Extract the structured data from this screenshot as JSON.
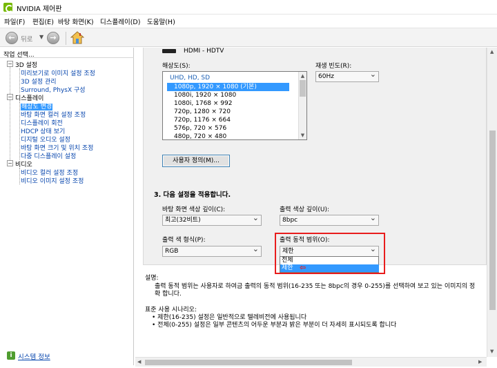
{
  "window": {
    "title": "NVIDIA 제어판"
  },
  "menu": [
    "파일(F)",
    "편집(E)",
    "바탕 화면(K)",
    "디스플레이(D)",
    "도움말(H)"
  ],
  "toolbar": {
    "back_label": "뒤로"
  },
  "task_panel": {
    "title": "작업 선택...",
    "groups": [
      {
        "label": "3D 설정",
        "items": [
          "미리보기로 이미지 설정 조정",
          "3D 설정 관리",
          "Surround, PhysX 구성"
        ]
      },
      {
        "label": "디스플레이",
        "items": [
          "해상도 변경",
          "바탕 화면 컬러 설정 조정",
          "디스플레이 회전",
          "HDCP 상태 보기",
          "디지털 오디오 설정",
          "바탕 화면 크기 및 위치 조정",
          "다중 디스플레이 설정"
        ]
      },
      {
        "label": "비디오",
        "items": [
          "비디오 컬러 설정 조정",
          "비디오 이미지 설정 조정"
        ]
      }
    ],
    "selected_item": "해상도 변경",
    "system_info": "시스템 정보"
  },
  "main": {
    "display_name": "HDMI - HDTV",
    "resolution_label": "해상도(S):",
    "resolution_list": [
      "UHD, HD, SD",
      "1080p, 1920 × 1080 (기본)",
      "1080i, 1920 × 1080",
      "1080i, 1768 × 992",
      "720p, 1280 × 720",
      "720p, 1176 × 664",
      "576p, 720 × 576",
      "480p, 720 × 480"
    ],
    "refresh_label": "재생 빈도(R):",
    "refresh_value": "60Hz",
    "custom_button": "사용자 정의(M)...",
    "step3_title": "3. 다음 설정을 적용합니다.",
    "desktop_depth_label": "바탕 화면 색상 깊이(C):",
    "desktop_depth_value": "최고(32비트)",
    "output_depth_label": "출력 색상 깊이(U):",
    "output_depth_value": "8bpc",
    "output_format_label": "출력 색 형식(P):",
    "output_format_value": "RGB",
    "output_range_label": "출력 동적 범위(O):",
    "output_range_value": "제한",
    "output_range_options": [
      "전체",
      "제한"
    ]
  },
  "description": {
    "heading": "설명:",
    "line1": "출력 동적 범위는 사용자로 하여금 출력의 동적 범위(16-235 또는 8bpc의 경우 0-255)를 선택하여 보고 있는 이미지의 정",
    "line2": "확 합니다.",
    "scenario_heading": "표준 사용 시나리오:",
    "bullet1": "• 제한(16-235) 설정은 일반적으로 텔레비전에 사용됩니다",
    "bullet2": "• 전체(0-255) 설정은 일부 콘텐츠의 어두운 부분과 밝은 부분이 더 자세히 표시되도록 합니다"
  }
}
